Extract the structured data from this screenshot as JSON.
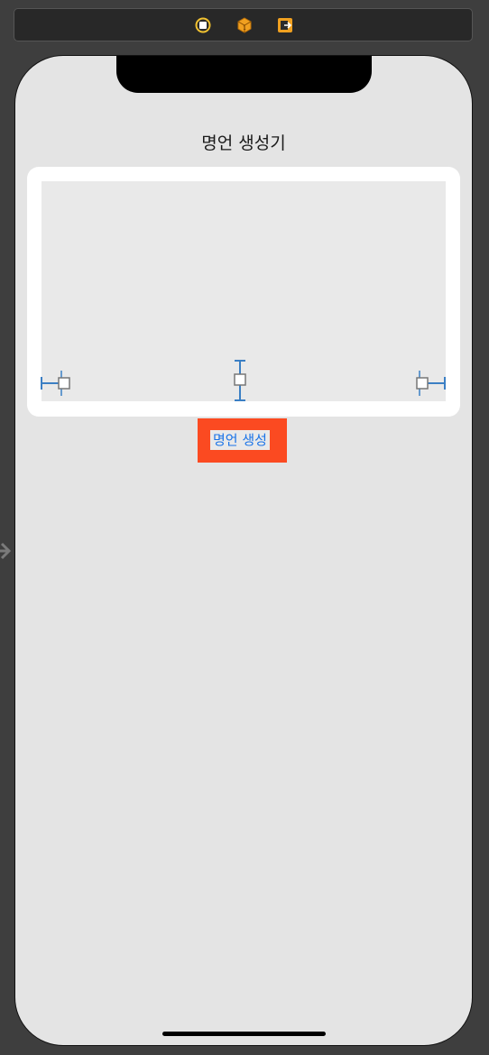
{
  "scene_dock": {
    "icons": [
      {
        "name": "view-controller-icon",
        "color": "#f2c230"
      },
      {
        "name": "first-responder-icon",
        "color": "#f0a020"
      },
      {
        "name": "exit-icon",
        "color": "#f0a020"
      }
    ]
  },
  "screen": {
    "title": "명언 생성기",
    "quote_text": "",
    "generate_button_label": "명언 생성",
    "colors": {
      "background": "#e4e4e4",
      "card": "#ffffff",
      "label_bg": "#e9e9e9",
      "button_bg": "#fb4a21",
      "button_text": "#1a73e8",
      "constraint": "#3b7fc4"
    }
  }
}
